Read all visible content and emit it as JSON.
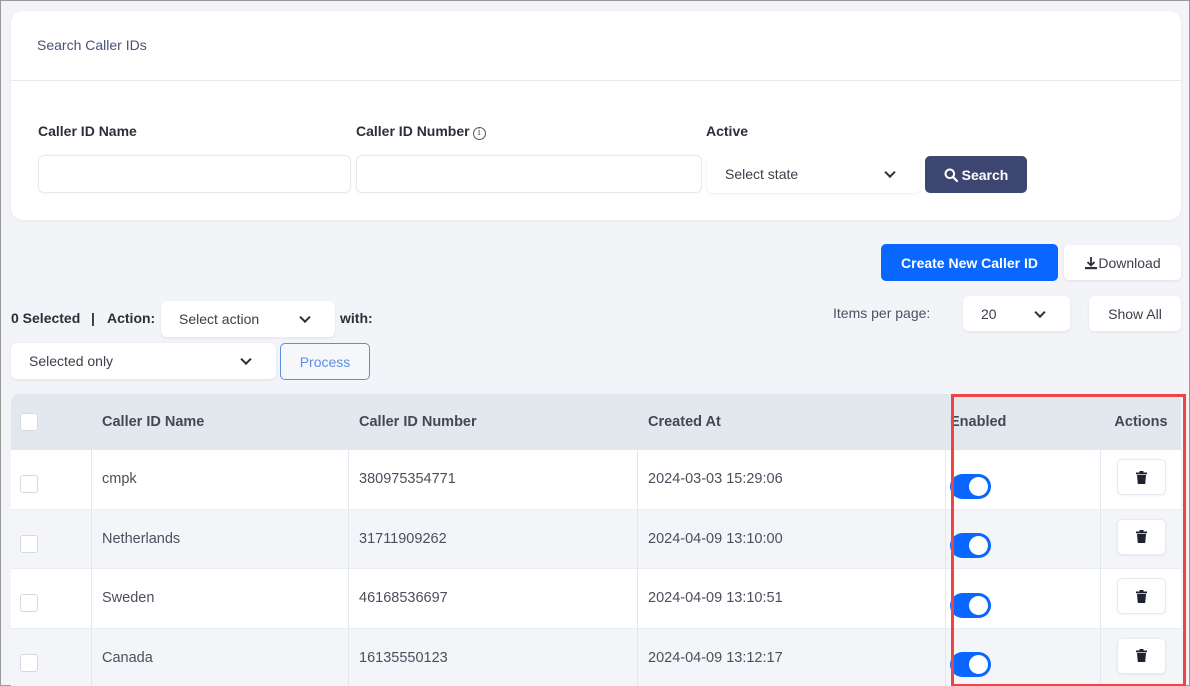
{
  "search_card": {
    "title": "Search Caller IDs",
    "fields": {
      "caller_id_name": {
        "label": "Caller ID Name",
        "value": "",
        "placeholder": ""
      },
      "caller_id_number": {
        "label": "Caller ID Number",
        "value": "",
        "placeholder": "",
        "info_icon": "info-icon"
      },
      "active": {
        "label": "Active",
        "selected": "Select state"
      }
    },
    "search_button": "Search"
  },
  "toolbar": {
    "create_button": "Create New Caller ID",
    "download_button": "Download",
    "items_per_page_label": "Items per page:",
    "items_per_page_value": "20",
    "show_all_button": "Show All"
  },
  "bulk_actions": {
    "selected_count": "0 Selected",
    "separator": "|",
    "action_label": "Action:",
    "action_selected": "Select action",
    "with_label": "with:",
    "scope_selected": "Selected only",
    "process_button": "Process"
  },
  "table": {
    "columns": [
      "Caller ID Name",
      "Caller ID Number",
      "Created At",
      "Enabled",
      "Actions"
    ],
    "rows": [
      {
        "name": "cmpk",
        "number": "380975354771",
        "created_at": "2024-03-03 15:29:06",
        "enabled": true
      },
      {
        "name": "Netherlands",
        "number": "31711909262",
        "created_at": "2024-04-09 13:10:00",
        "enabled": true
      },
      {
        "name": "Sweden",
        "number": "46168536697",
        "created_at": "2024-04-09 13:10:51",
        "enabled": true
      },
      {
        "name": "Canada",
        "number": "16135550123",
        "created_at": "2024-04-09 13:12:17",
        "enabled": true
      }
    ]
  },
  "colors": {
    "primary": "#0967ff",
    "search_button": "#3d4670",
    "highlight": "#ef4444"
  }
}
